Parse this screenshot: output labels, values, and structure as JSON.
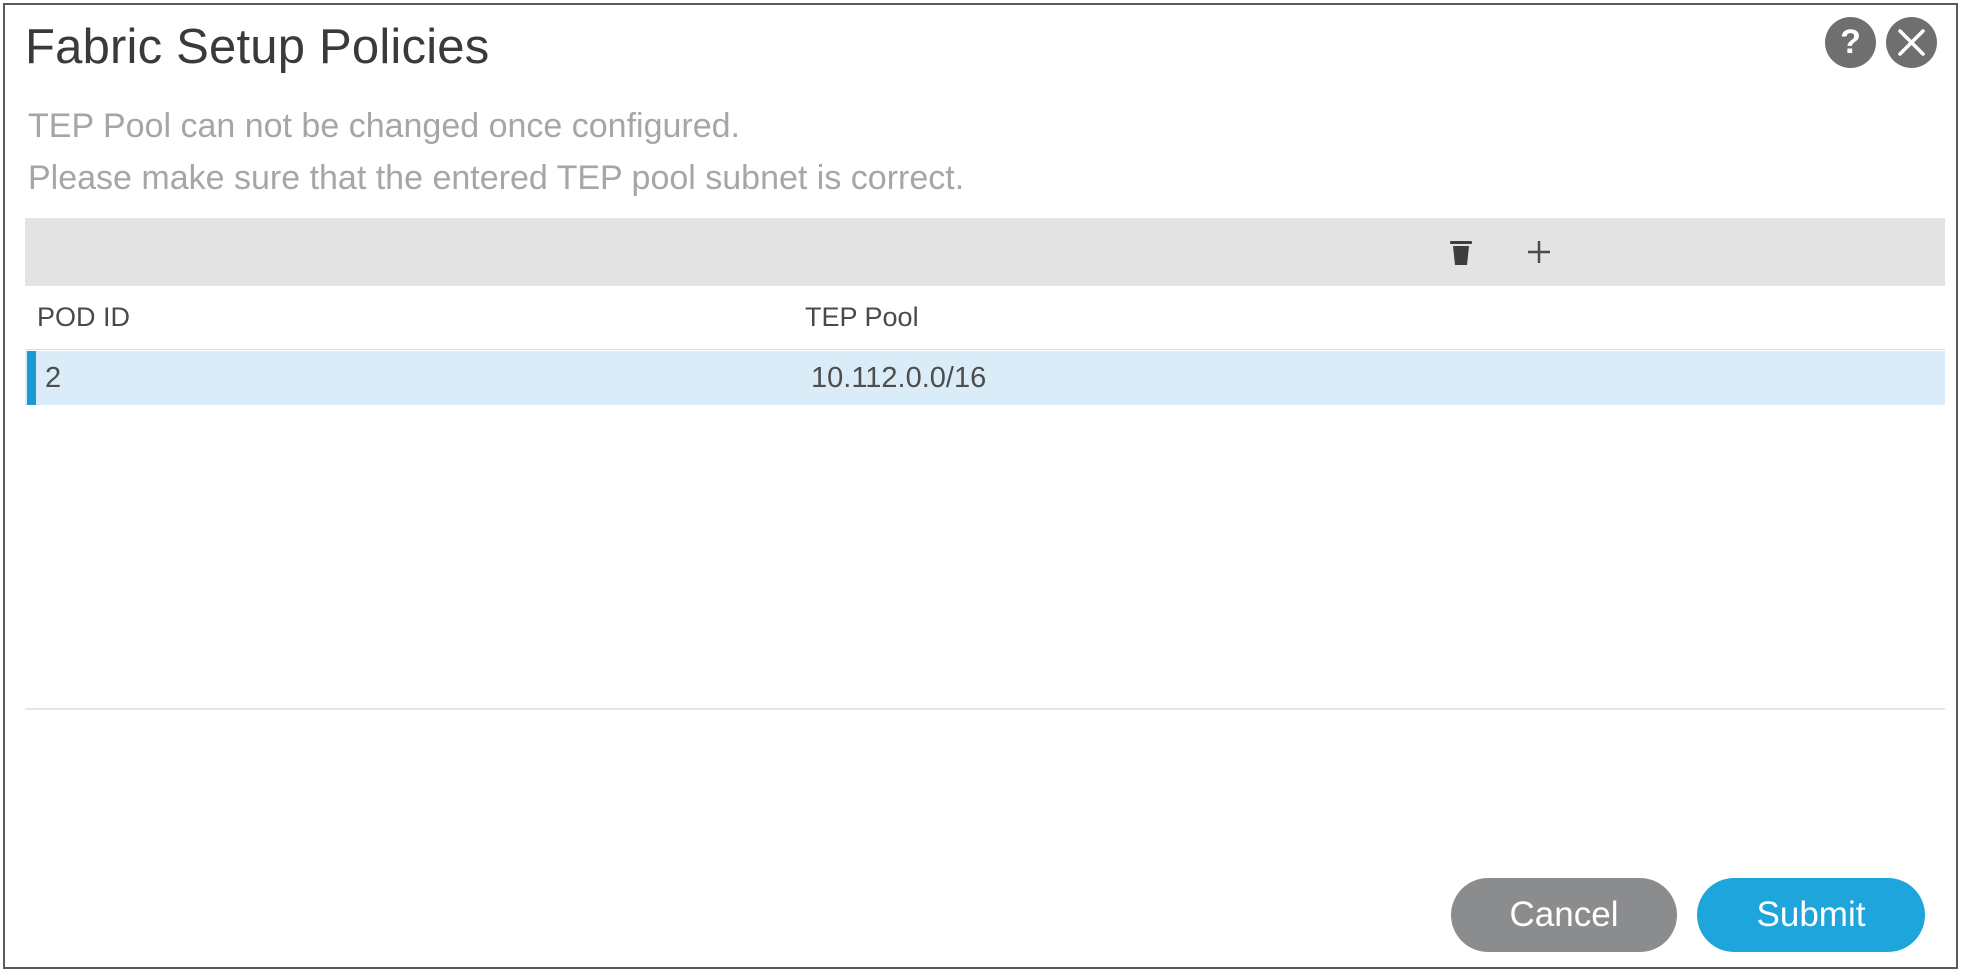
{
  "dialog": {
    "title": "Fabric Setup Policies",
    "notes": [
      "TEP Pool can not be changed once configured.",
      "Please make sure that the entered TEP pool subnet is correct."
    ],
    "icons": {
      "help": "help-icon",
      "close": "close-icon",
      "delete": "trash-icon",
      "add": "plus-icon"
    }
  },
  "table": {
    "columns": [
      "POD ID",
      "TEP Pool"
    ],
    "rows": [
      {
        "pod_id": "2",
        "tep_pool": "10.112.0.0/16",
        "selected": true
      }
    ]
  },
  "footer": {
    "cancel_label": "Cancel",
    "submit_label": "Submit"
  },
  "colors": {
    "accent": "#1ea6dc",
    "selection": "#d9ecf7",
    "selection_marker": "#1b9bd4",
    "cancel": "#8b8c8e",
    "icon": "#6e6f71"
  }
}
